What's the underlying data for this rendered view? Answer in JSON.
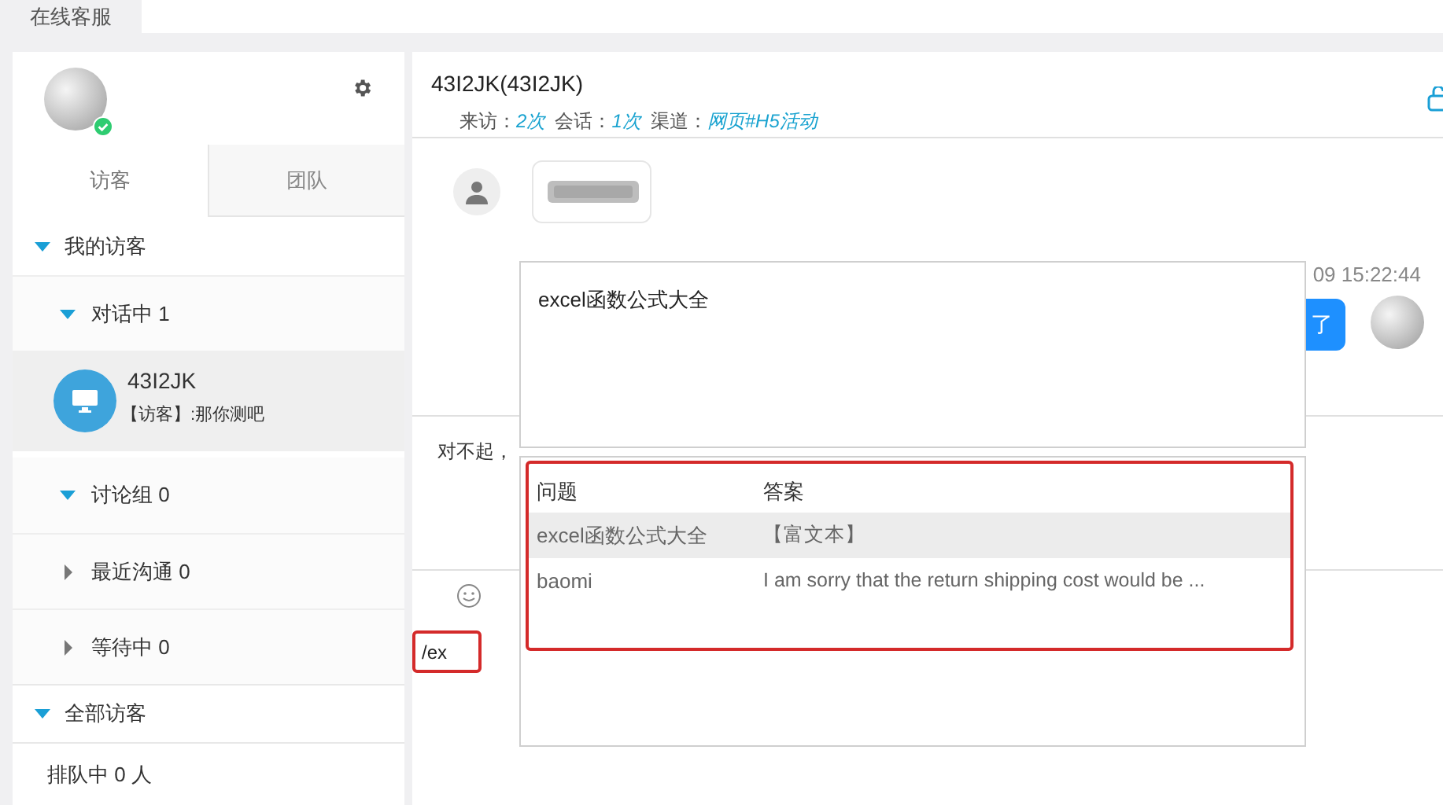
{
  "top_tabs": [
    {
      "label": "在线客服",
      "selected": true
    }
  ],
  "agent": {
    "online": true
  },
  "side_tabs": [
    {
      "label": "访客",
      "selected": true
    },
    {
      "label": "团队",
      "selected": false
    }
  ],
  "tree": [
    {
      "label": "我的访客",
      "expanded": true,
      "children": [
        {
          "label": "对话中 1",
          "expanded": true,
          "children": [
            {
              "kind": "visitor",
              "name": "43I2JK",
              "message": "【访客】:那你测吧",
              "selected": true
            }
          ]
        },
        {
          "label": "讨论组 0",
          "expanded": true
        },
        {
          "label": "最近沟通 0",
          "expanded": false
        },
        {
          "label": "等待中 0",
          "expanded": false
        }
      ]
    },
    {
      "label": "全部访客",
      "expanded": true
    }
  ],
  "queue": "排队中 0 人",
  "chat": {
    "title": "43I2JK(43I2JK)",
    "stats": [
      {
        "label": "来访：",
        "value": "2次"
      },
      {
        "label": "会话：",
        "value": "1次"
      },
      {
        "label": "渠道：",
        "value": "网页#H5活动"
      }
    ],
    "agent_time": "09 15:22:44",
    "agent_bubble": "了",
    "reply": "对不起，"
  },
  "preview": {
    "text": "excel函数公式大全"
  },
  "suggestions": {
    "columns": [
      "问题",
      "答案"
    ],
    "rows": [
      {
        "question": "excel函数公式大全",
        "answer": "【富文本】",
        "selected": true
      },
      {
        "question": "baomi",
        "answer": "I am sorry that the return shipping cost would be ...",
        "selected": false
      }
    ]
  },
  "input": {
    "value": "/ex"
  }
}
